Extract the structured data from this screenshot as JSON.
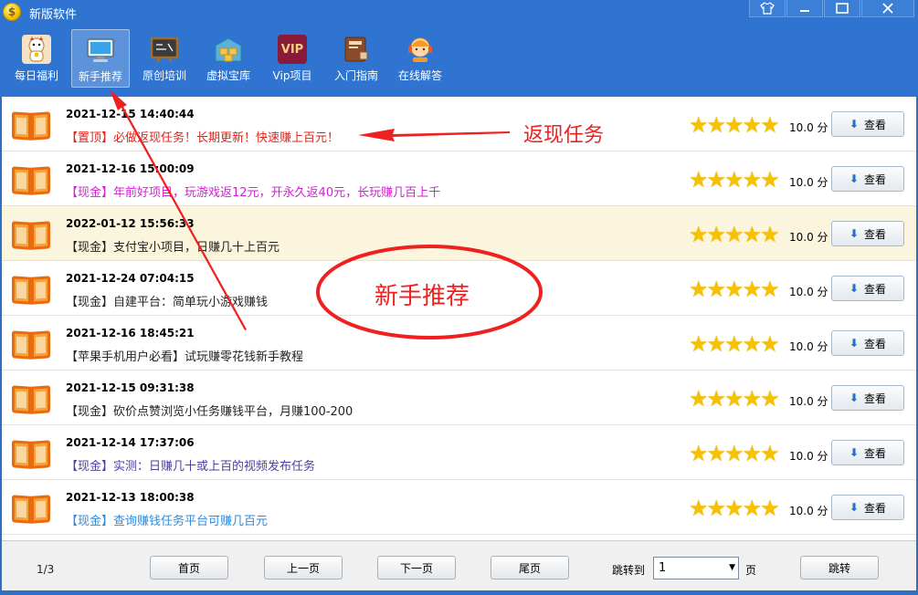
{
  "window": {
    "title": "新版软件",
    "app_icon": "$",
    "controls": [
      "shirt-icon",
      "minimize-icon",
      "maximize-icon",
      "close-icon"
    ]
  },
  "toolbar": {
    "items": [
      {
        "label": "每日福利",
        "icon": "lucky-cat-icon",
        "active": false
      },
      {
        "label": "新手推荐",
        "icon": "monitor-icon",
        "active": true
      },
      {
        "label": "原创培训",
        "icon": "blackboard-icon",
        "active": false
      },
      {
        "label": "虚拟宝库",
        "icon": "warehouse-icon",
        "active": false
      },
      {
        "label": "Vip项目",
        "icon": "vip-icon",
        "active": false
      },
      {
        "label": "入门指南",
        "icon": "book-guide-icon",
        "active": false
      },
      {
        "label": "在线解答",
        "icon": "support-agent-icon",
        "active": false
      }
    ],
    "vip_badge": "VIP"
  },
  "list": {
    "view_label": "查看",
    "score_unit": "分",
    "stars": "★★★★★",
    "items": [
      {
        "date": "2021-12-15 14:40:44",
        "title": "【置顶】必做返现任务！长期更新！快速赚上百元！",
        "color": "#e2231a",
        "score": "10.0",
        "highlight": false
      },
      {
        "date": "2021-12-16 15:00:09",
        "title": "【现金】年前好项目，玩游戏返12元，开永久返40元，长玩赚几百上千",
        "color": "#d21fd2",
        "score": "10.0",
        "highlight": false
      },
      {
        "date": "2022-01-12 15:56:33",
        "title": "【现金】支付宝小项目，日赚几十上百元",
        "color": "#222222",
        "score": "10.0",
        "highlight": true
      },
      {
        "date": "2021-12-24 07:04:15",
        "title": "【现金】自建平台：简单玩小游戏赚钱",
        "color": "#222222",
        "score": "10.0",
        "highlight": false
      },
      {
        "date": "2021-12-16 18:45:21",
        "title": "【苹果手机用户必看】试玩赚零花钱新手教程",
        "color": "#222222",
        "score": "10.0",
        "highlight": false
      },
      {
        "date": "2021-12-15 09:31:38",
        "title": "【现金】砍价点赞浏览小任务赚钱平台，月赚100-200",
        "color": "#222222",
        "score": "10.0",
        "highlight": false
      },
      {
        "date": "2021-12-14 17:37:06",
        "title": "【现金】实测：日赚几十或上百的视频发布任务",
        "color": "#4b3fa6",
        "score": "10.0",
        "highlight": false
      },
      {
        "date": "2021-12-13 18:00:38",
        "title": "【现金】查询赚钱任务平台可赚几百元",
        "color": "#2b8be0",
        "score": "10.0",
        "highlight": false
      }
    ]
  },
  "pager": {
    "page_info": "1/3",
    "first": "首页",
    "prev": "上一页",
    "next": "下一页",
    "last": "尾页",
    "jump_label": "跳转到",
    "jump_value": "1",
    "page_unit": "页",
    "jump_button": "跳转"
  },
  "annotations": {
    "arrow_label": "返现任务",
    "circle_label": "新手推荐",
    "color": "#ef2020"
  }
}
